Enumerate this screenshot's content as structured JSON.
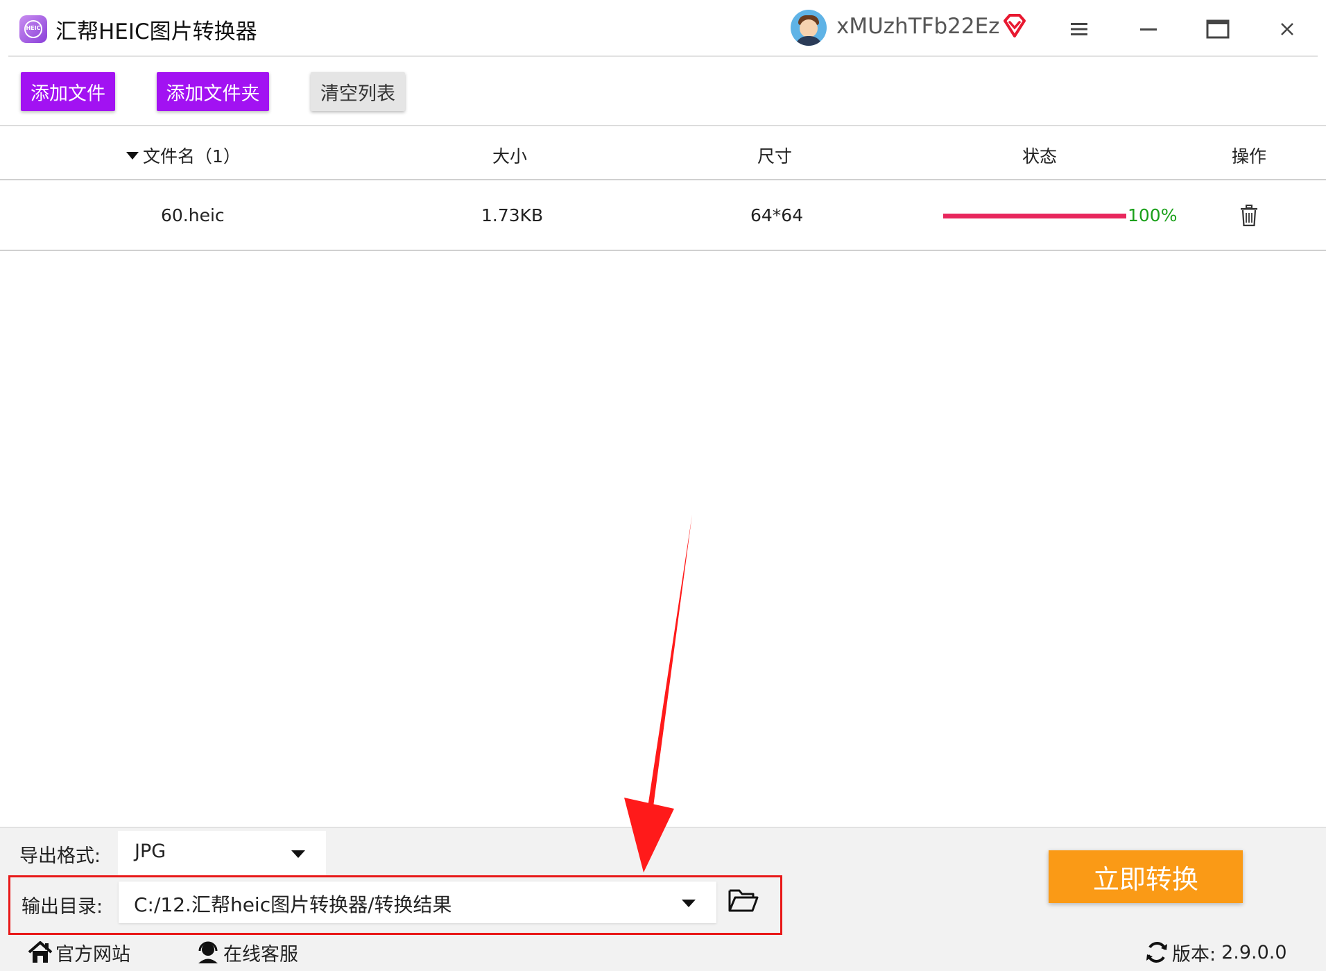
{
  "app": {
    "title": "汇帮HEIC图片转换器",
    "logo_text": "HEIC",
    "icon": "app-logo-icon",
    "user": {
      "name": "xMUzhTFb22Ez",
      "avatar_icon": "user-avatar-icon",
      "badge_icon": "vip-diamond-icon"
    },
    "window_controls": [
      "menu-icon",
      "minimize-icon",
      "maximize-icon",
      "close-icon"
    ]
  },
  "toolbar": {
    "add_file": "添加文件",
    "add_folder": "添加文件夹",
    "clear_list": "清空列表",
    "accent_color": "#a212f2"
  },
  "table": {
    "columns": [
      "文件名（1）",
      "大小",
      "尺寸",
      "状态",
      "操作"
    ],
    "rows": [
      {
        "name": "60.heic",
        "size": "1.73KB",
        "dimensions": "64*64",
        "progress": 100,
        "progress_label": "100%",
        "action_icon": "trash-icon"
      }
    ],
    "progress_color": "#e8275d",
    "status_text_color": "#1aa01a"
  },
  "bottom": {
    "format_label": "导出格式:",
    "format_value": "JPG",
    "output_label": "输出目录:",
    "output_value": "C:/12.汇帮heic图片转换器/转换结果",
    "folder_icon": "folder-open-icon",
    "convert_label": "立即转换",
    "convert_color": "#fa9a16"
  },
  "footer": {
    "website": "官方网站",
    "support": "在线客服",
    "version_label": "版本:",
    "version_value": "2.9.0.0",
    "icons": [
      "home-icon",
      "headset-icon",
      "refresh-icon"
    ]
  },
  "annotation": {
    "highlight_color": "#e81818",
    "arrow_icon": "red-arrow-icon"
  }
}
